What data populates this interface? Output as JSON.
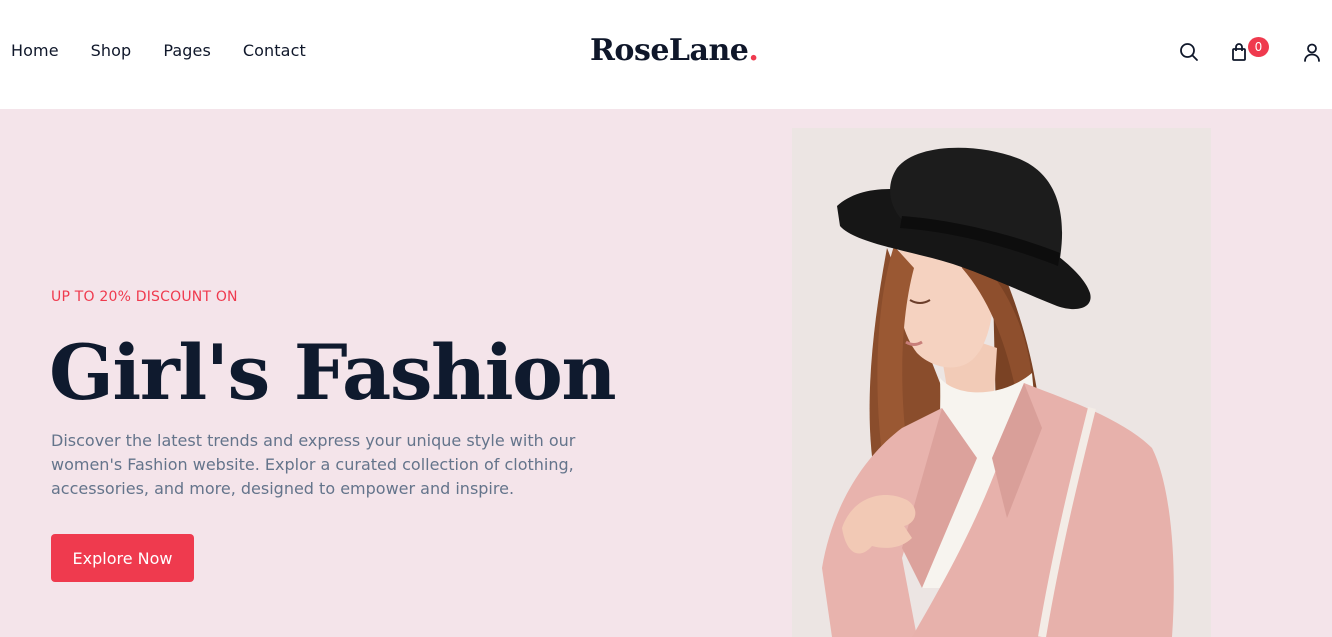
{
  "nav": {
    "items": [
      {
        "label": "Home"
      },
      {
        "label": "Shop"
      },
      {
        "label": "Pages"
      },
      {
        "label": "Contact"
      }
    ]
  },
  "brand": {
    "name": "RoseLane",
    "dot": "."
  },
  "header_icons": {
    "search": "search-icon",
    "cart": "bag-icon",
    "account": "user-icon",
    "cart_count": "0"
  },
  "hero": {
    "eyebrow": "UP TO 20% DISCOUNT ON",
    "title": "Girl's Fashion",
    "description": "Discover the latest trends and express your unique style with our women's Fashion website. Explor a curated collection of clothing, accessories, and more, designed to empower and inspire.",
    "cta_label": "Explore Now"
  },
  "colors": {
    "accent": "#ef3a4e",
    "hero_bg": "#f4e4ea",
    "text_dark": "#0f172a",
    "text_muted": "#64748b"
  }
}
